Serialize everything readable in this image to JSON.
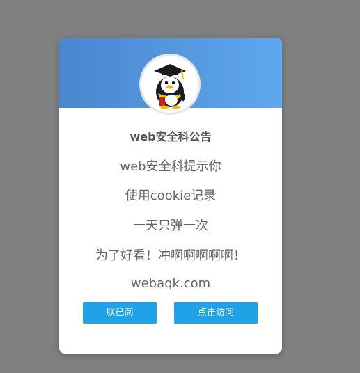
{
  "modal": {
    "title": "web安全科公告",
    "lines": [
      "web安全科提示你",
      "使用cookie记录",
      "一天只弹一次",
      "为了好看！冲啊啊啊啊啊！",
      "webaqk.com"
    ],
    "buttons": {
      "read_label": "朕已阅",
      "visit_label": "点击访问"
    },
    "avatar_icon": "penguin-graduate-icon"
  },
  "colors": {
    "overlay": "#808080",
    "header_gradient_start": "#4a86cf",
    "header_gradient_end": "#5ea8ee",
    "button": "#1fa3e6"
  }
}
